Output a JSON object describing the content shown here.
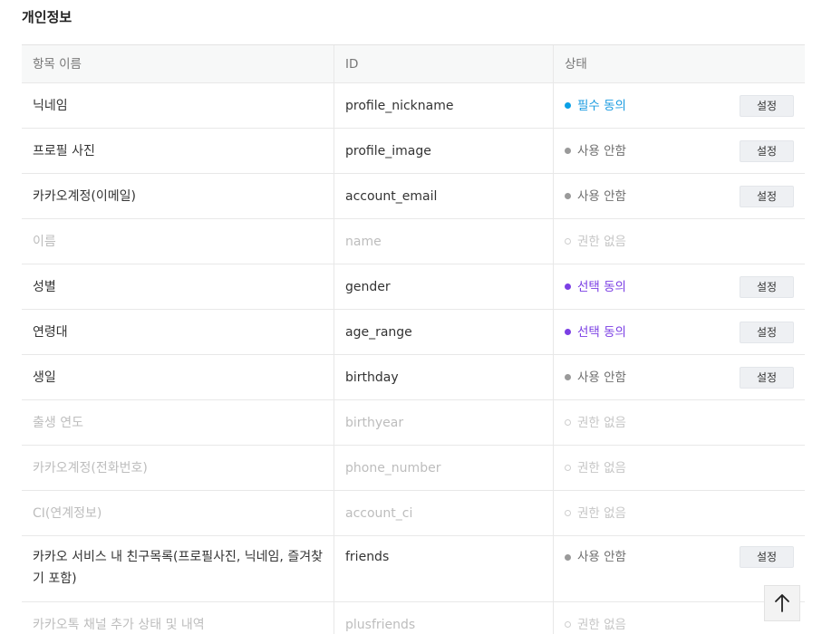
{
  "section_title": "개인정보",
  "table": {
    "headers": {
      "name": "항목 이름",
      "id": "ID",
      "status": "상태"
    },
    "rows": [
      {
        "name": "닉네임",
        "id": "profile_nickname",
        "status": "필수 동의",
        "status_type": "required",
        "button": "설정"
      },
      {
        "name": "프로필 사진",
        "id": "profile_image",
        "status": "사용 안함",
        "status_type": "unused",
        "button": "설정"
      },
      {
        "name": "카카오계정(이메일)",
        "id": "account_email",
        "status": "사용 안함",
        "status_type": "unused",
        "button": "설정"
      },
      {
        "name": "이름",
        "id": "name",
        "status": "권한 없음",
        "status_type": "none"
      },
      {
        "name": "성별",
        "id": "gender",
        "status": "선택 동의",
        "status_type": "optional",
        "button": "설정"
      },
      {
        "name": "연령대",
        "id": "age_range",
        "status": "선택 동의",
        "status_type": "optional",
        "button": "설정"
      },
      {
        "name": "생일",
        "id": "birthday",
        "status": "사용 안함",
        "status_type": "unused",
        "button": "설정"
      },
      {
        "name": "출생 연도",
        "id": "birthyear",
        "status": "권한 없음",
        "status_type": "none"
      },
      {
        "name": "카카오계정(전화번호)",
        "id": "phone_number",
        "status": "권한 없음",
        "status_type": "none"
      },
      {
        "name": "CI(연계정보)",
        "id": "account_ci",
        "status": "권한 없음",
        "status_type": "none"
      },
      {
        "name": "카카오 서비스 내 친구목록(프로필사진, 닉네임, 즐겨찾기 포함)",
        "id": "friends",
        "status": "사용 안함",
        "status_type": "unused",
        "button": "설정"
      },
      {
        "name": "카카오톡 채널 추가 상태 및 내역",
        "id": "plusfriends",
        "status": "권한 없음",
        "status_type": "none"
      }
    ]
  },
  "colors": {
    "required": "#1a9be0",
    "optional": "#7b3fe4",
    "unused": "#6f6f6f",
    "none": "#c6c6c6"
  },
  "icons": {
    "scroll_top": "arrow-up-icon"
  }
}
